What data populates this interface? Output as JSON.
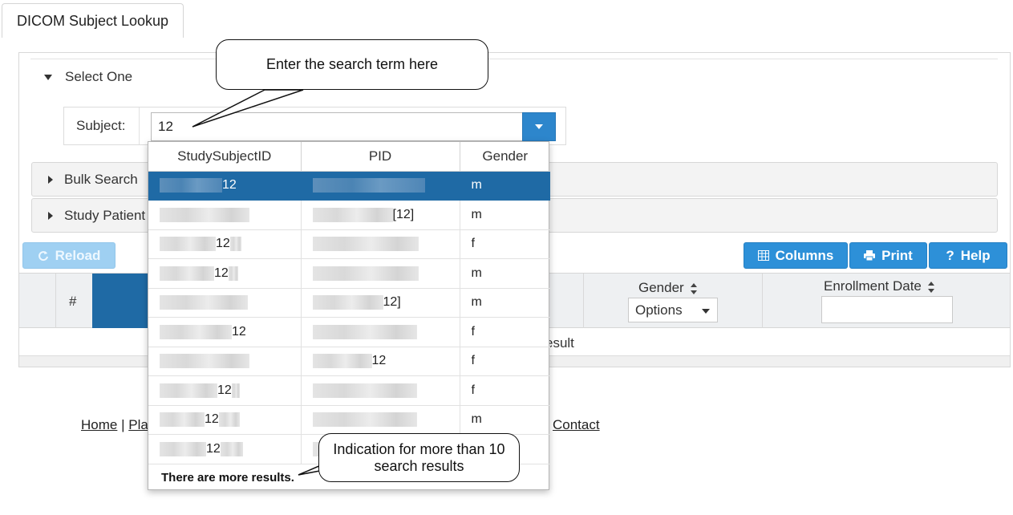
{
  "tab": {
    "title": "DICOM Subject Lookup"
  },
  "select_one": {
    "label": "Select One",
    "subject_label": "Subject:",
    "subject_value": "12"
  },
  "sections": {
    "bulk_search": "Bulk Search",
    "study_patient": "Study Patient"
  },
  "toolbar": {
    "reload": "Reload",
    "columns": "Columns",
    "print": "Print",
    "help": "Help"
  },
  "grid": {
    "hash": "#",
    "gender_header": "Gender",
    "gender_filter": "Options",
    "enrollment_header": "Enrollment Date",
    "result_text": "esult"
  },
  "dropdown": {
    "headers": [
      "StudySubjectID",
      "PID",
      "Gender"
    ],
    "rows": [
      {
        "id": "12",
        "pid": "",
        "gender": "m",
        "selected": true
      },
      {
        "id": "",
        "pid": "[12]",
        "gender": "m"
      },
      {
        "id": "12",
        "pid": "",
        "gender": "f"
      },
      {
        "id": "12",
        "pid": "",
        "gender": "m"
      },
      {
        "id": "",
        "pid": "12]",
        "gender": "m"
      },
      {
        "id": "12",
        "pid": "",
        "gender": "f"
      },
      {
        "id": "",
        "pid": "12",
        "gender": "f"
      },
      {
        "id": "12",
        "pid": "",
        "gender": "f"
      },
      {
        "id": "12",
        "pid": "",
        "gender": "m"
      },
      {
        "id": "12",
        "pid": "",
        "gender": ""
      }
    ],
    "more_results": "There are more results."
  },
  "footer": {
    "home": "Home",
    "pla": "Pla",
    "contact": "Contact"
  },
  "callouts": {
    "search": "Enter the search term here",
    "more": "Indication for more than 10 search results"
  },
  "colors": {
    "primary": "#2d90d8",
    "selected": "#1f6aa5"
  },
  "icons": [
    "reload-icon",
    "columns-icon",
    "print-icon",
    "help-icon",
    "caret-down-icon"
  ]
}
